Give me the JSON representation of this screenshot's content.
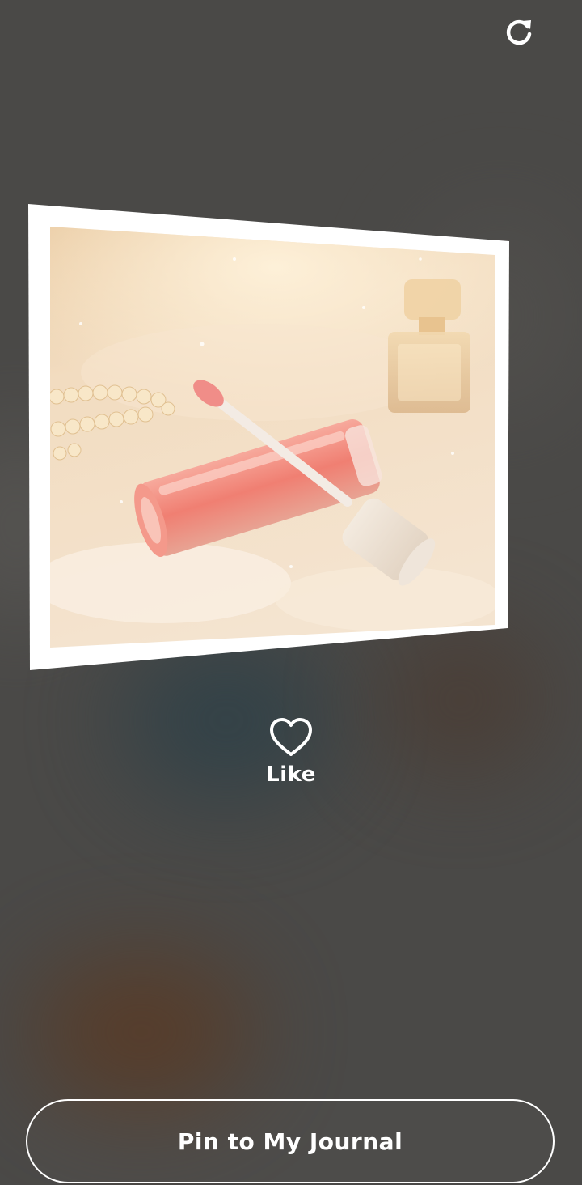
{
  "header": {
    "refresh_icon": "refresh-icon"
  },
  "photo": {
    "subject": "pink lip gloss",
    "frame_color": "#ffffff"
  },
  "like": {
    "label": "Like",
    "icon": "heart-outline-icon"
  },
  "pin": {
    "label": "Pin to My Journal"
  },
  "colors": {
    "background": "#4a4947",
    "text": "#ffffff"
  }
}
